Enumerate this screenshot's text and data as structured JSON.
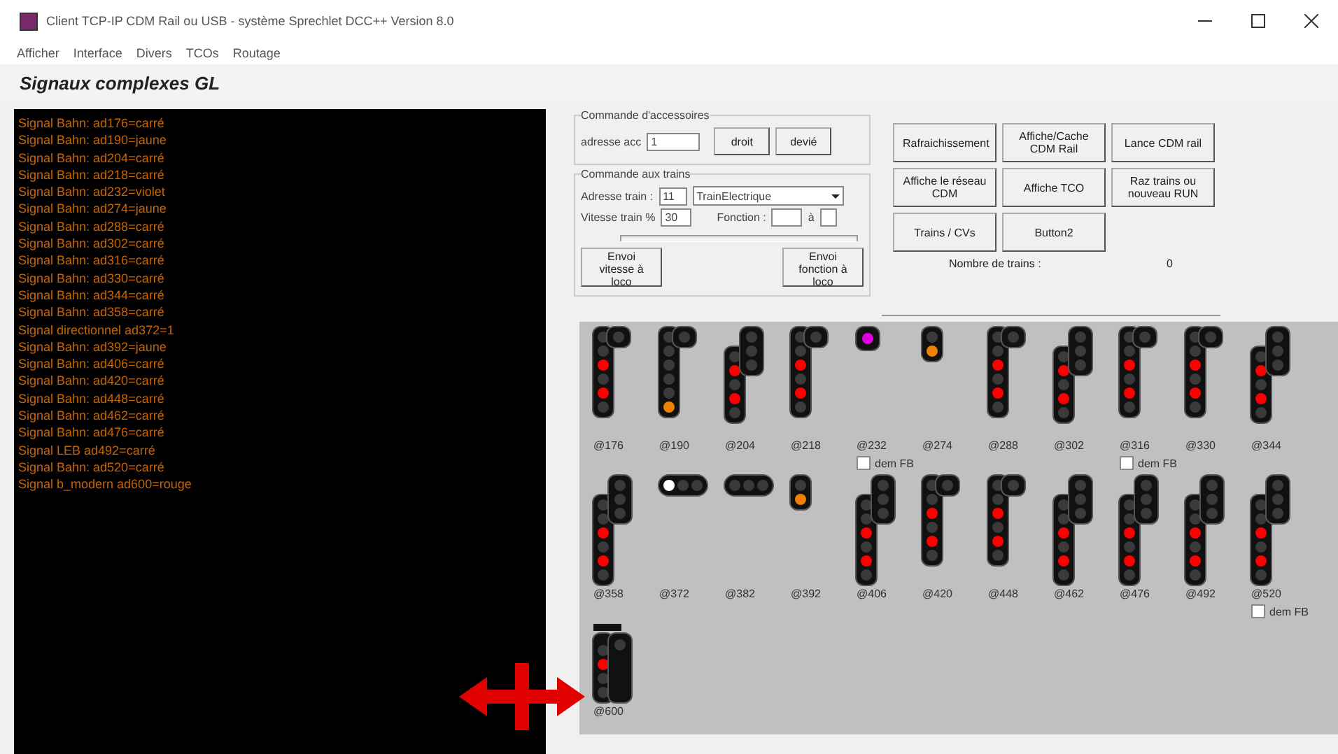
{
  "window": {
    "title": "Client TCP-IP CDM Rail ou USB - système Sprechlet DCC++ Version 8.0"
  },
  "menu": [
    "Afficher",
    "Interface",
    "Divers",
    "TCOs",
    "Routage"
  ],
  "heading": "Signaux complexes GL",
  "log": [
    "Signal Bahn: ad176=carré",
    "Signal Bahn: ad190=jaune",
    "Signal Bahn: ad204=carré",
    "Signal Bahn: ad218=carré",
    "Signal Bahn: ad232=violet",
    "Signal Bahn: ad274=jaune",
    "Signal Bahn: ad288=carré",
    "Signal Bahn: ad302=carré",
    "Signal Bahn: ad316=carré",
    "Signal Bahn: ad330=carré",
    "Signal Bahn: ad344=carré",
    "Signal Bahn: ad358=carré",
    "Signal directionnel ad372=1",
    "Signal Bahn: ad392=jaune",
    "Signal Bahn: ad406=carré",
    "Signal Bahn: ad420=carré",
    "Signal Bahn: ad448=carré",
    "Signal Bahn: ad462=carré",
    "Signal Bahn: ad476=carré",
    "Signal LEB ad492=carré",
    "Signal Bahn: ad520=carré",
    "Signal b_modern ad600=rouge"
  ],
  "accessories": {
    "title": "Commande d'accessoires",
    "address_label": "adresse acc",
    "address": "1",
    "buttons": [
      "droit",
      "devié"
    ]
  },
  "trains": {
    "title": "Commande aux trains",
    "address_label": "Adresse train :",
    "address": "11",
    "train": "TrainElectrique",
    "speed_label": "Vitesse train %",
    "speed": "30",
    "function_label": "Fonction :",
    "to_label": "à",
    "buttons": [
      "Envoi vitesse à loco",
      "Envoi fonction à loco"
    ]
  },
  "actions": [
    "Rafraichissement",
    "Affiche/Cache CDM Rail",
    "Lance CDM rail",
    "Affiche le réseau CDM",
    "Affiche TCO",
    "Raz trains ou nouveau RUN",
    "Trains / CVs",
    "Button2"
  ],
  "train_count": {
    "label": "Nombre de trains :",
    "value": "0"
  },
  "signals": [
    {
      "label": "@176",
      "kind": "gl",
      "lamps": [
        {
          "lit": false
        },
        {
          "lit": false
        },
        {
          "lit": true,
          "color": "#ff0000"
        },
        {
          "lit": false
        },
        {
          "lit": true,
          "color": "#ff0000"
        },
        {
          "lit": false
        }
      ]
    },
    {
      "label": "@190",
      "kind": "gl",
      "lamps": [
        {
          "lit": false
        },
        {
          "lit": false
        },
        {
          "lit": false
        },
        {
          "lit": false
        },
        {
          "lit": false
        },
        {
          "lit": true,
          "color": "#f08000"
        }
      ]
    },
    {
      "label": "@204",
      "kind": "raised",
      "lamps": [
        {
          "lit": false
        },
        {
          "lit": true,
          "color": "#ff0000"
        },
        {
          "lit": false
        },
        {
          "lit": true,
          "color": "#ff0000"
        },
        {
          "lit": false
        }
      ]
    },
    {
      "label": "@218",
      "kind": "gl",
      "lamps": [
        {
          "lit": false
        },
        {
          "lit": false
        },
        {
          "lit": true,
          "color": "#ff0000"
        },
        {
          "lit": false
        },
        {
          "lit": true,
          "color": "#ff0000"
        },
        {
          "lit": false
        }
      ]
    },
    {
      "label": "@232",
      "kind": "dot",
      "lamps": [
        {
          "lit": true,
          "color": "#e000e0"
        }
      ],
      "checkbox": {
        "label": "dem FB",
        "checked": false
      }
    },
    {
      "label": "@274",
      "kind": "small",
      "lamps": [
        {
          "lit": false
        },
        {
          "lit": true,
          "color": "#f08000"
        }
      ]
    },
    {
      "label": "@288",
      "kind": "gl",
      "lamps": [
        {
          "lit": false
        },
        {
          "lit": false
        },
        {
          "lit": true,
          "color": "#ff0000"
        },
        {
          "lit": false
        },
        {
          "lit": true,
          "color": "#ff0000"
        },
        {
          "lit": false
        }
      ]
    },
    {
      "label": "@302",
      "kind": "raised",
      "lamps": [
        {
          "lit": false
        },
        {
          "lit": true,
          "color": "#ff0000"
        },
        {
          "lit": false
        },
        {
          "lit": true,
          "color": "#ff0000"
        },
        {
          "lit": false
        }
      ]
    },
    {
      "label": "@316",
      "kind": "gl",
      "lamps": [
        {
          "lit": false
        },
        {
          "lit": false
        },
        {
          "lit": true,
          "color": "#ff0000"
        },
        {
          "lit": false
        },
        {
          "lit": true,
          "color": "#ff0000"
        },
        {
          "lit": false
        }
      ],
      "checkbox": {
        "label": "dem FB",
        "checked": false
      }
    },
    {
      "label": "@330",
      "kind": "gl",
      "lamps": [
        {
          "lit": false
        },
        {
          "lit": false
        },
        {
          "lit": true,
          "color": "#ff0000"
        },
        {
          "lit": false
        },
        {
          "lit": true,
          "color": "#ff0000"
        },
        {
          "lit": false
        }
      ]
    },
    {
      "label": "@344",
      "kind": "raised",
      "lamps": [
        {
          "lit": false
        },
        {
          "lit": true,
          "color": "#ff0000"
        },
        {
          "lit": false
        },
        {
          "lit": true,
          "color": "#ff0000"
        },
        {
          "lit": false
        }
      ]
    },
    {
      "label": "@358",
      "kind": "raised",
      "lamps": [
        {
          "lit": false
        },
        {
          "lit": false
        },
        {
          "lit": true,
          "color": "#ff0000"
        },
        {
          "lit": false
        },
        {
          "lit": true,
          "color": "#ff0000"
        },
        {
          "lit": false
        }
      ]
    },
    {
      "label": "@372",
      "kind": "horizontal",
      "lamps": [
        {
          "lit": true,
          "color": "#ffffff"
        },
        {
          "lit": false
        },
        {
          "lit": false
        }
      ]
    },
    {
      "label": "@382",
      "kind": "horizontal",
      "lamps": [
        {
          "lit": false
        },
        {
          "lit": false
        },
        {
          "lit": false
        }
      ]
    },
    {
      "label": "@392",
      "kind": "small",
      "lamps": [
        {
          "lit": false
        },
        {
          "lit": true,
          "color": "#f08000"
        }
      ]
    },
    {
      "label": "@406",
      "kind": "raised",
      "lamps": [
        {
          "lit": false
        },
        {
          "lit": false
        },
        {
          "lit": true,
          "color": "#ff0000"
        },
        {
          "lit": false
        },
        {
          "lit": true,
          "color": "#ff0000"
        },
        {
          "lit": false
        }
      ]
    },
    {
      "label": "@420",
      "kind": "gl",
      "lamps": [
        {
          "lit": false
        },
        {
          "lit": false
        },
        {
          "lit": true,
          "color": "#ff0000"
        },
        {
          "lit": false
        },
        {
          "lit": true,
          "color": "#ff0000"
        },
        {
          "lit": false
        }
      ]
    },
    {
      "label": "@448",
      "kind": "gl",
      "lamps": [
        {
          "lit": false
        },
        {
          "lit": false
        },
        {
          "lit": true,
          "color": "#ff0000"
        },
        {
          "lit": false
        },
        {
          "lit": true,
          "color": "#ff0000"
        },
        {
          "lit": false
        }
      ]
    },
    {
      "label": "@462",
      "kind": "raised",
      "lamps": [
        {
          "lit": false
        },
        {
          "lit": false
        },
        {
          "lit": true,
          "color": "#ff0000"
        },
        {
          "lit": false
        },
        {
          "lit": true,
          "color": "#ff0000"
        },
        {
          "lit": false
        }
      ]
    },
    {
      "label": "@476",
      "kind": "raised",
      "lamps": [
        {
          "lit": false
        },
        {
          "lit": false
        },
        {
          "lit": true,
          "color": "#ff0000"
        },
        {
          "lit": false
        },
        {
          "lit": true,
          "color": "#ff0000"
        },
        {
          "lit": false
        }
      ]
    },
    {
      "label": "@492",
      "kind": "raised",
      "lamps": [
        {
          "lit": false
        },
        {
          "lit": false
        },
        {
          "lit": true,
          "color": "#ff0000"
        },
        {
          "lit": false
        },
        {
          "lit": true,
          "color": "#ff0000"
        },
        {
          "lit": false
        }
      ]
    },
    {
      "label": "@520",
      "kind": "raised",
      "lamps": [
        {
          "lit": false
        },
        {
          "lit": false
        },
        {
          "lit": true,
          "color": "#ff0000"
        },
        {
          "lit": false
        },
        {
          "lit": true,
          "color": "#ff0000"
        },
        {
          "lit": false
        }
      ],
      "checkbox": {
        "label": "dem FB",
        "checked": false
      }
    },
    {
      "label": "@600",
      "kind": "block",
      "lamps": [
        {
          "lit": false
        },
        {
          "lit": true,
          "color": "#ff0000"
        },
        {
          "lit": false
        },
        {
          "lit": false
        }
      ]
    }
  ]
}
